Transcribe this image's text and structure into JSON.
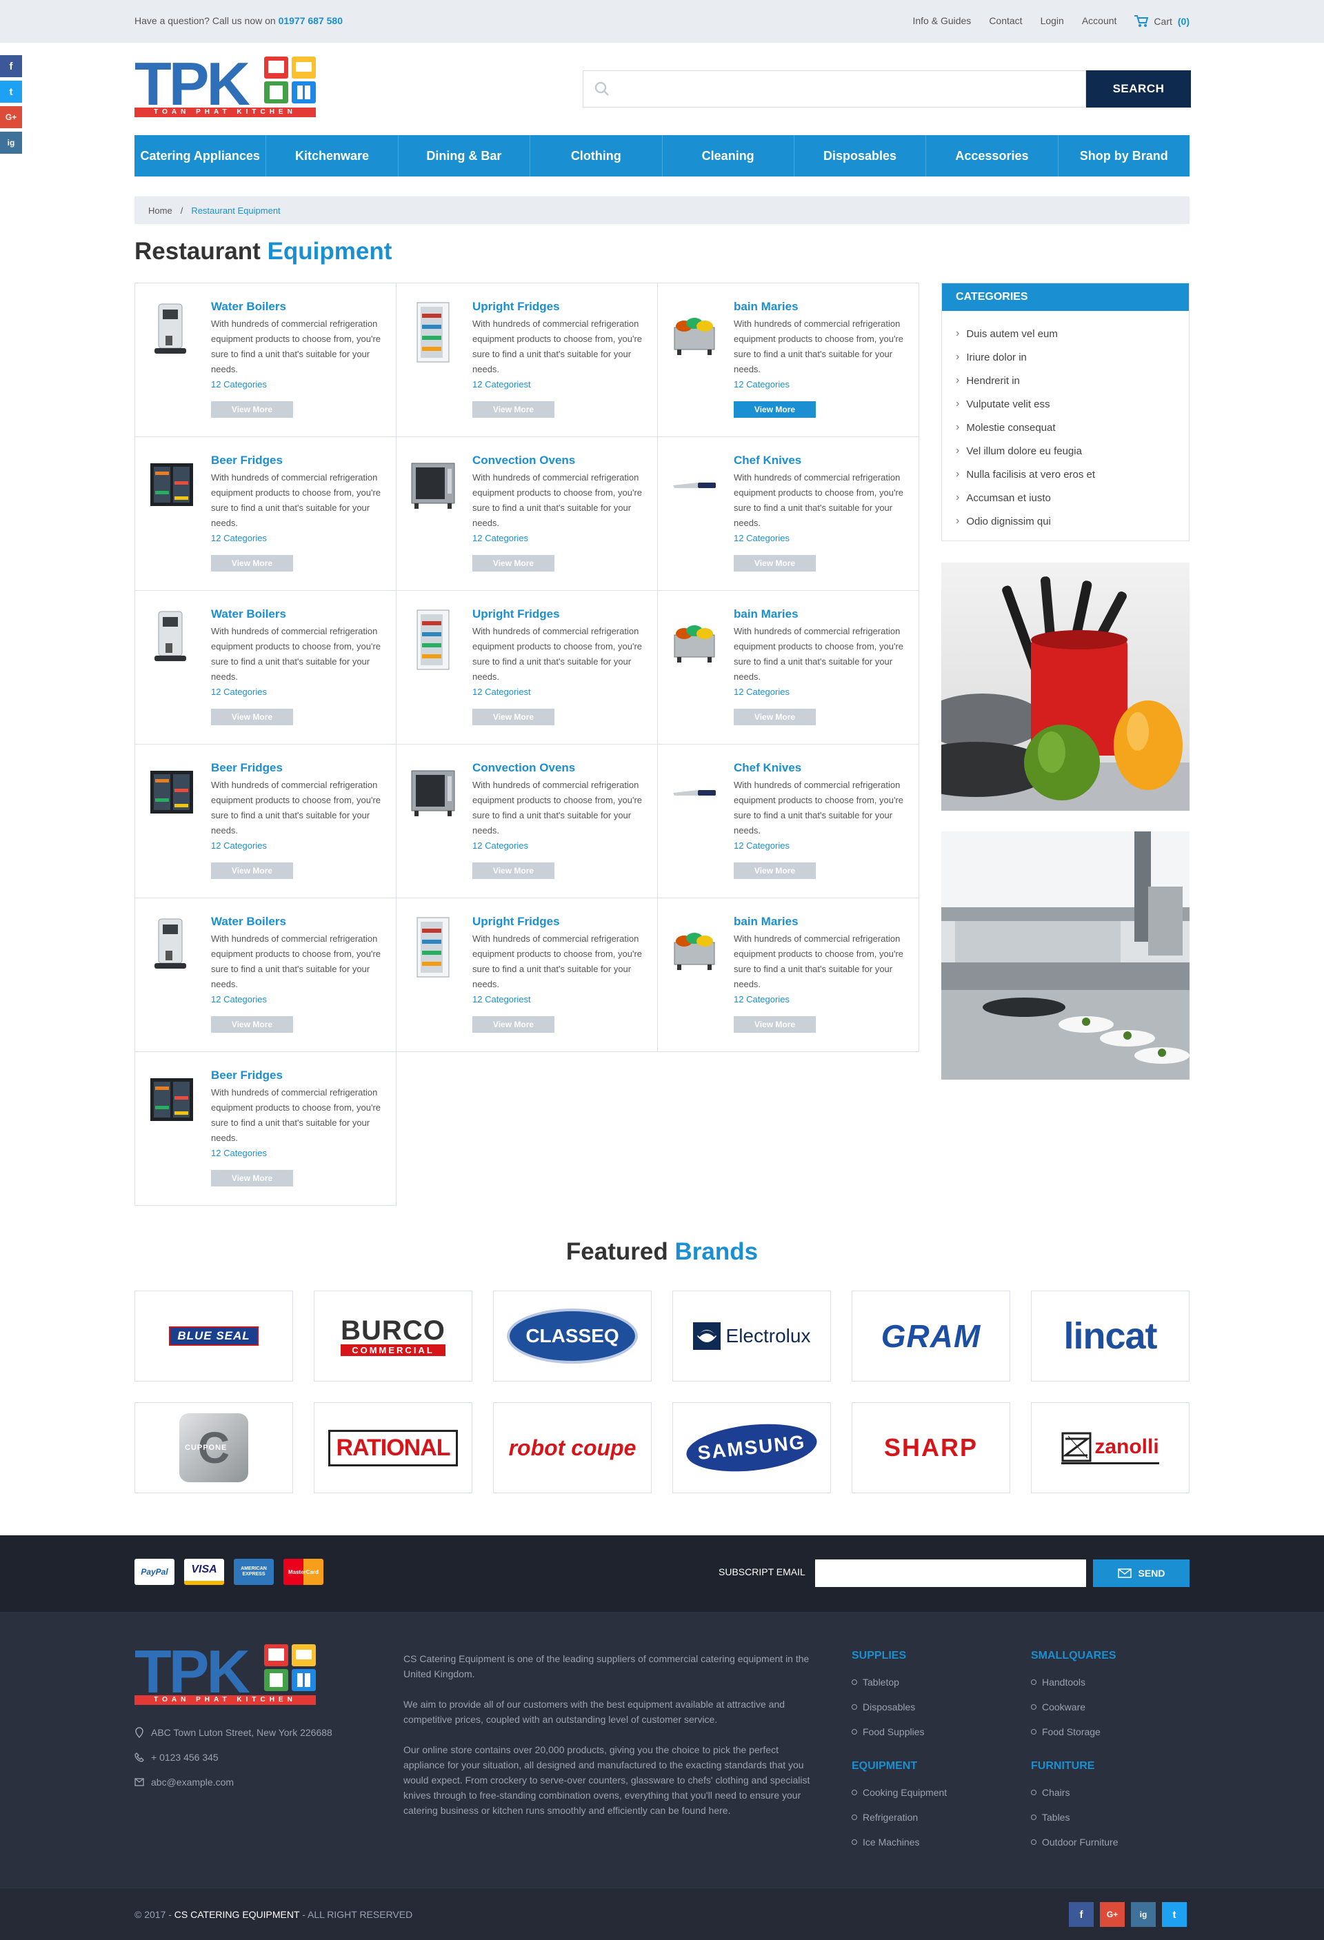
{
  "topbar": {
    "question": "Have a question? Call us now on",
    "phone": "01977 687 580",
    "links": [
      "Info & Guides",
      "Contact",
      "Login",
      "Account"
    ],
    "cart_label": "Cart",
    "cart_count": "(0)"
  },
  "logo": {
    "text": "TPK",
    "tagline": "TOAN PHAT KITCHEN"
  },
  "search": {
    "placeholder": "",
    "button": "SEARCH"
  },
  "nav": [
    "Catering Appliances",
    "Kitchenware",
    "Dining & Bar",
    "Clothing",
    "Cleaning",
    "Disposables",
    "Accessories",
    "Shop by Brand"
  ],
  "breadcrumb": {
    "home": "Home",
    "sep": "/",
    "current": "Restaurant Equipment"
  },
  "page_title": {
    "a": "Restaurant",
    "b": "Equipment"
  },
  "products": [
    {
      "name": "Water Boilers",
      "desc": "With hundreds of commercial refrigeration equipment products to choose from, you're sure to find a unit that's suitable for your needs.",
      "cats": "12 Categories",
      "btn": "View More",
      "icon": "water-boiler",
      "active": false
    },
    {
      "name": "Upright Fridges",
      "desc": "With hundreds of commercial refrigeration equipment products to choose from, you're sure to find a unit that's suitable for your needs.",
      "cats": "12 Categoriest",
      "btn": "View More",
      "icon": "upright-fridge",
      "active": false
    },
    {
      "name": "bain Maries",
      "desc": "With hundreds of commercial refrigeration equipment products to choose from, you're sure to find a unit that's suitable for your needs.",
      "cats": "12 Categories",
      "btn": "View More",
      "icon": "bain-marie",
      "active": true
    },
    {
      "name": "Beer Fridges",
      "desc": "With hundreds of commercial refrigeration equipment products to choose from, you're sure to find a unit that's suitable for your needs.",
      "cats": "12 Categories",
      "btn": "View More",
      "icon": "beer-fridge",
      "active": false
    },
    {
      "name": "Convection Ovens",
      "desc": "With hundreds of commercial refrigeration equipment products to choose from, you're sure to find a unit that's suitable for your needs.",
      "cats": "12 Categories",
      "btn": "View More",
      "icon": "convection-oven",
      "active": false
    },
    {
      "name": "Chef Knives",
      "desc": "With hundreds of commercial refrigeration equipment products to choose from, you're sure to find a unit that's suitable for your needs.",
      "cats": "12 Categories",
      "btn": "View More",
      "icon": "chef-knife",
      "active": false
    },
    {
      "name": "Water Boilers",
      "desc": "With hundreds of commercial refrigeration equipment products to choose from, you're sure to find a unit that's suitable for your needs.",
      "cats": "12 Categories",
      "btn": "View More",
      "icon": "water-boiler",
      "active": false
    },
    {
      "name": "Upright Fridges",
      "desc": "With hundreds of commercial refrigeration equipment products to choose from, you're sure to find a unit that's suitable for your needs.",
      "cats": "12 Categoriest",
      "btn": "View More",
      "icon": "upright-fridge",
      "active": false
    },
    {
      "name": "bain Maries",
      "desc": "With hundreds of commercial refrigeration equipment products to choose from, you're sure to find a unit that's suitable for your needs.",
      "cats": "12 Categories",
      "btn": "View More",
      "icon": "bain-marie",
      "active": false
    },
    {
      "name": "Beer Fridges",
      "desc": "With hundreds of commercial refrigeration equipment products to choose from, you're sure to find a unit that's suitable for your needs.",
      "cats": "12 Categories",
      "btn": "View More",
      "icon": "beer-fridge",
      "active": false
    },
    {
      "name": "Convection Ovens",
      "desc": "With hundreds of commercial refrigeration equipment products to choose from, you're sure to find a unit that's suitable for your needs.",
      "cats": "12 Categories",
      "btn": "View More",
      "icon": "convection-oven",
      "active": false
    },
    {
      "name": "Chef Knives",
      "desc": "With hundreds of commercial refrigeration equipment products to choose from, you're sure to find a unit that's suitable for your needs.",
      "cats": "12 Categories",
      "btn": "View More",
      "icon": "chef-knife",
      "active": false
    },
    {
      "name": "Water Boilers",
      "desc": "With hundreds of commercial refrigeration equipment products to choose from, you're sure to find a unit that's suitable for your needs.",
      "cats": "12 Categories",
      "btn": "View More",
      "icon": "water-boiler",
      "active": false
    },
    {
      "name": "Upright Fridges",
      "desc": "With hundreds of commercial refrigeration equipment products to choose from, you're sure to find a unit that's suitable for your needs.",
      "cats": "12 Categoriest",
      "btn": "View More",
      "icon": "upright-fridge",
      "active": false
    },
    {
      "name": "bain Maries",
      "desc": "With hundreds of commercial refrigeration equipment products to choose from, you're sure to find a unit that's suitable for your needs.",
      "cats": "12 Categories",
      "btn": "View More",
      "icon": "bain-marie",
      "active": false
    },
    {
      "name": "Beer Fridges",
      "desc": "With hundreds of commercial refrigeration equipment products to choose from, you're sure to find a unit that's suitable for your needs.",
      "cats": "12 Categories",
      "btn": "View More",
      "icon": "beer-fridge",
      "active": false
    }
  ],
  "categories": {
    "title": "CATEGORIES",
    "items": [
      "Duis autem vel eum",
      "Iriure dolor in",
      "Hendrerit in",
      "Vulputate velit ess",
      "Molestie consequat",
      "Vel illum dolore eu feugia",
      "Nulla facilisis at vero eros et",
      "Accumsan et iusto",
      "Odio dignissim qui"
    ]
  },
  "brands_title": {
    "a": "Featured",
    "b": "Brands"
  },
  "brands": [
    "BLUE SEAL",
    "BURCO",
    "COMMERCIAL",
    "CLASSEQ",
    "Electrolux",
    "GRAM",
    "lincat",
    "C",
    "CUPPONE",
    "RATIONAL",
    "robot coupe",
    "SAMSUNG",
    "SHARP",
    "zanolli"
  ],
  "payments": [
    "PayPal",
    "VISA",
    "AMERICAN EXPRESS",
    "MasterCard"
  ],
  "subscribe": {
    "label": "SUBSCRIPT EMAIL",
    "placeholder": "",
    "button": "SEND"
  },
  "footer": {
    "address": "ABC Town Luton Street, New York 226688",
    "phone": "+ 0123 456 345",
    "email": "abc@example.com",
    "about": [
      "CS Catering Equipment is one of the leading suppliers of commercial catering equipment in the United Kingdom.",
      "We aim to provide all of our customers with the best equipment available at attractive and competitive prices, coupled with an outstanding level of customer service.",
      "Our online store contains over 20,000 products, giving you the choice to pick the perfect appliance for your situation, all designed and manufactured to the exacting standards that you would expect. From crockery to serve-over counters, glassware to chefs' clothing and specialist knives through to free-standing combination ovens, everything that you'll need to ensure your catering business or kitchen runs smoothly and efficiently can be found here."
    ],
    "cols": [
      {
        "title": "SUPPLIES",
        "items": [
          "Tabletop",
          "Disposables",
          "Food Supplies"
        ]
      },
      {
        "title": "SMALLQUARES",
        "items": [
          "Handtools",
          "Cookware",
          "Food Storage"
        ]
      },
      {
        "title": "EQUIPMENT",
        "items": [
          "Cooking Equipment",
          "Refrigeration",
          "Ice Machines"
        ]
      },
      {
        "title": "FURNITURE",
        "items": [
          "Chairs",
          "Tables",
          "Outdoor Furniture"
        ]
      }
    ],
    "copyright_pre": "© 2017 -",
    "copyright_brand": "CS CATERING EQUIPMENT",
    "copyright_post": "- ALL RIGHT RESERVED"
  },
  "social": [
    "f",
    "t",
    "G+",
    "ig"
  ],
  "colors": {
    "accent": "#1a8fd1",
    "navy": "#0f2a4f",
    "footer": "#2a303d"
  }
}
